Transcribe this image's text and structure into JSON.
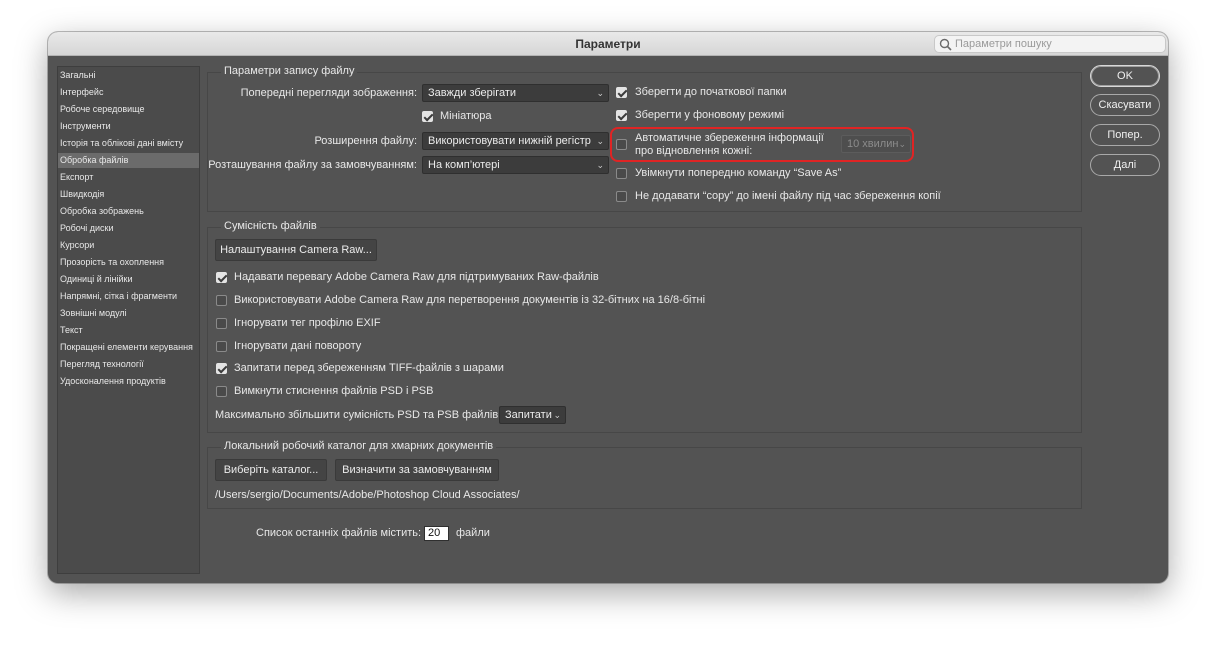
{
  "window": {
    "title": "Параметри",
    "search_placeholder": "Параметри пошуку"
  },
  "sidebar": {
    "items": [
      {
        "label": "Загальні"
      },
      {
        "label": "Інтерфейс"
      },
      {
        "label": "Робоче середовище"
      },
      {
        "label": "Інструменти"
      },
      {
        "label": "Історія та облікові дані вмісту"
      },
      {
        "label": "Обробка файлів",
        "selected": true
      },
      {
        "label": "Експорт"
      },
      {
        "label": "Швидкодія"
      },
      {
        "label": "Обробка зображень"
      },
      {
        "label": "Робочі диски"
      },
      {
        "label": "Курсори"
      },
      {
        "label": "Прозорість та охоплення"
      },
      {
        "label": "Одиниці й лінійки"
      },
      {
        "label": "Напрямні, сітка і фрагменти"
      },
      {
        "label": "Зовнішні модулі"
      },
      {
        "label": "Текст"
      },
      {
        "label": "Покращені елементи керування"
      },
      {
        "label": "Перегляд технології"
      },
      {
        "label": "Удосконалення продуктів"
      }
    ]
  },
  "file_saving": {
    "title": "Параметри запису файлу",
    "image_previews_label": "Попередні перегляди зображення:",
    "image_previews_value": "Завжди зберігати",
    "thumbnail_label": "Мініатюра",
    "thumbnail_checked": true,
    "extension_label": "Розширення файлу:",
    "extension_value": "Використовувати нижній регістр",
    "location_label": "Розташування файлу за замовчуванням:",
    "location_value": "На комп’ютері",
    "save_to_original_label": "Зберегти до початкової папки",
    "save_to_original_checked": true,
    "save_background_label": "Зберегти у фоновому режимі",
    "save_background_checked": true,
    "autosave_label_line1": "Автоматичне збереження інформації",
    "autosave_label_line2": "про відновлення кожні:",
    "autosave_checked": false,
    "autosave_interval": "10 хвилин",
    "legacy_save_as_label": "Увімкнути попередню команду “Save As”",
    "legacy_save_as_checked": false,
    "no_copy_label": "Не додавати “copy” до імені файлу під час збереження копії",
    "no_copy_checked": false
  },
  "compatibility": {
    "title": "Сумісність файлів",
    "camera_raw_button": "Налаштування Camera Raw...",
    "options": [
      {
        "label": "Надавати перевагу Adobe Camera Raw для підтримуваних Raw-файлів",
        "checked": true
      },
      {
        "label": "Використовувати Adobe Camera Raw для перетворення документів із 32-бітних на 16/8-бітні",
        "checked": false
      },
      {
        "label": "Ігнорувати тег профілю EXIF",
        "checked": false
      },
      {
        "label": "Ігнорувати дані повороту",
        "checked": false
      },
      {
        "label": "Запитати перед збереженням TIFF-файлів з шарами",
        "checked": true
      },
      {
        "label": "Вимкнути стиснення файлів PSD і PSB",
        "checked": false
      }
    ],
    "maximize_label": "Максимально збільшити сумісність PSD та PSB файлів:",
    "maximize_value": "Запитати"
  },
  "cloud": {
    "title": "Локальний робочий каталог для хмарних документів",
    "choose_button": "Виберіть каталог...",
    "default_button": "Визначити за замовчуванням",
    "path": "/Users/sergio/Documents/Adobe/Photoshop Cloud Associates/"
  },
  "recent": {
    "label": "Список останніх файлів містить:",
    "value": "20",
    "suffix": "файли"
  },
  "actions": {
    "ok": "OK",
    "cancel": "Скасувати",
    "prev": "Попер.",
    "next": "Далі"
  },
  "colors": {
    "dialog_bg": "#535353",
    "highlight": "#e02424"
  }
}
